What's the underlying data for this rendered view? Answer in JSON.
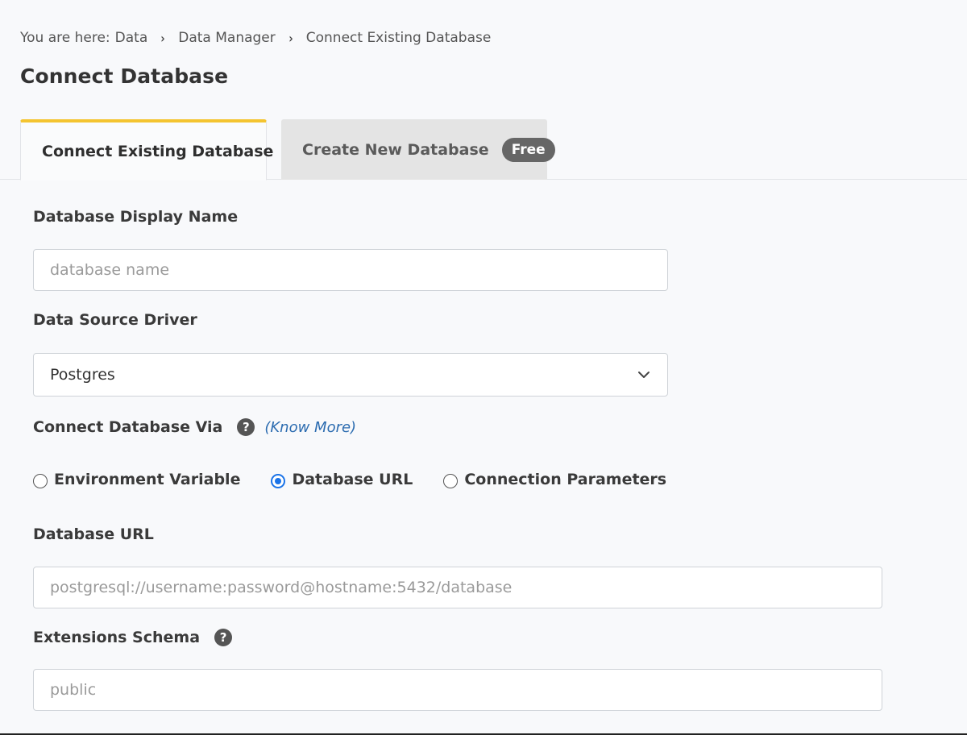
{
  "breadcrumb": {
    "prefix": "You are here:",
    "items": [
      "Data",
      "Data Manager",
      "Connect Existing Database"
    ],
    "separator": "›"
  },
  "page_title": "Connect Database",
  "tabs": [
    {
      "label": "Connect Existing Database",
      "active": true
    },
    {
      "label": "Create New Database",
      "badge": "Free",
      "active": false
    }
  ],
  "form": {
    "display_name": {
      "label": "Database Display Name",
      "value": "",
      "placeholder": "database name"
    },
    "driver": {
      "label": "Data Source Driver",
      "value": "Postgres",
      "icon": "chevron-down-icon"
    },
    "connect_via": {
      "label": "Connect Database Via",
      "help_icon": "?",
      "know_more": "(Know More)",
      "options": [
        {
          "label": "Environment Variable",
          "checked": false
        },
        {
          "label": "Database URL",
          "checked": true
        },
        {
          "label": "Connection Parameters",
          "checked": false
        }
      ]
    },
    "database_url": {
      "label": "Database URL",
      "value": "",
      "placeholder": "postgresql://username:password@hostname:5432/database"
    },
    "extensions_schema": {
      "label": "Extensions Schema",
      "help_icon": "?",
      "value": "",
      "placeholder": "public"
    }
  },
  "colors": {
    "active_tab_accent": "#f4c430",
    "radio_checked": "#1a73e8",
    "link": "#2c6cb0",
    "badge_bg": "#666666"
  }
}
